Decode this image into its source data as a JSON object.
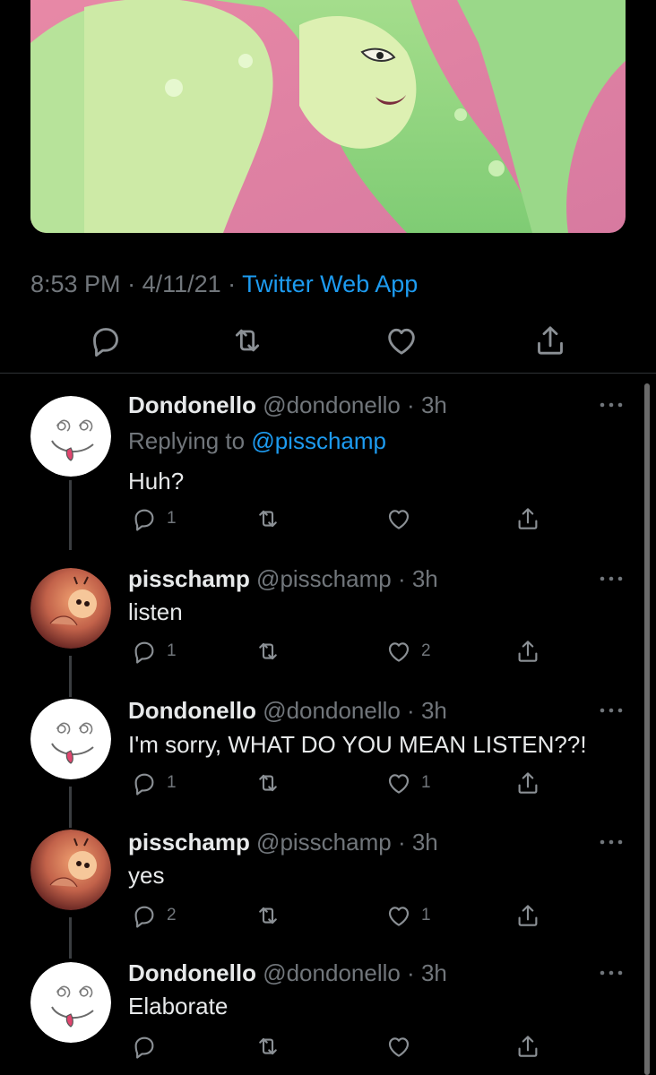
{
  "tweet": {
    "time": "8:53 PM",
    "sep1": " · ",
    "date": "4/11/21",
    "sep2": " · ",
    "source": "Twitter Web App"
  },
  "actions_icons": [
    "reply-icon",
    "retweet-icon",
    "like-icon",
    "share-icon"
  ],
  "colors": {
    "background": "#000000",
    "muted_text": "#71767b",
    "link_blue": "#1d9bf0",
    "primary_text": "#e7e9ea",
    "divider": "#2f3336"
  },
  "replies": [
    {
      "display_name": "Dondonello",
      "handle_time": " @dondonello · 3h",
      "replying_prefix": "Replying to ",
      "replying_to": "@pisschamp",
      "text": "Huh?",
      "reply_count": "1",
      "retweet_count": "",
      "like_count": ""
    },
    {
      "display_name": "pisschamp",
      "handle_time": " @pisschamp · 3h",
      "text": "listen",
      "reply_count": "1",
      "retweet_count": "",
      "like_count": "2"
    },
    {
      "display_name": "Dondonello",
      "handle_time": " @dondonello · 3h",
      "text": "I'm sorry, WHAT DO YOU MEAN LISTEN??!",
      "reply_count": "1",
      "retweet_count": "",
      "like_count": "1"
    },
    {
      "display_name": "pisschamp",
      "handle_time": " @pisschamp · 3h",
      "text": "yes",
      "reply_count": "2",
      "retweet_count": "",
      "like_count": "1"
    },
    {
      "display_name": "Dondonello",
      "handle_time": " @dondonello · 3h",
      "text": "Elaborate",
      "reply_count": "",
      "retweet_count": "",
      "like_count": ""
    }
  ]
}
